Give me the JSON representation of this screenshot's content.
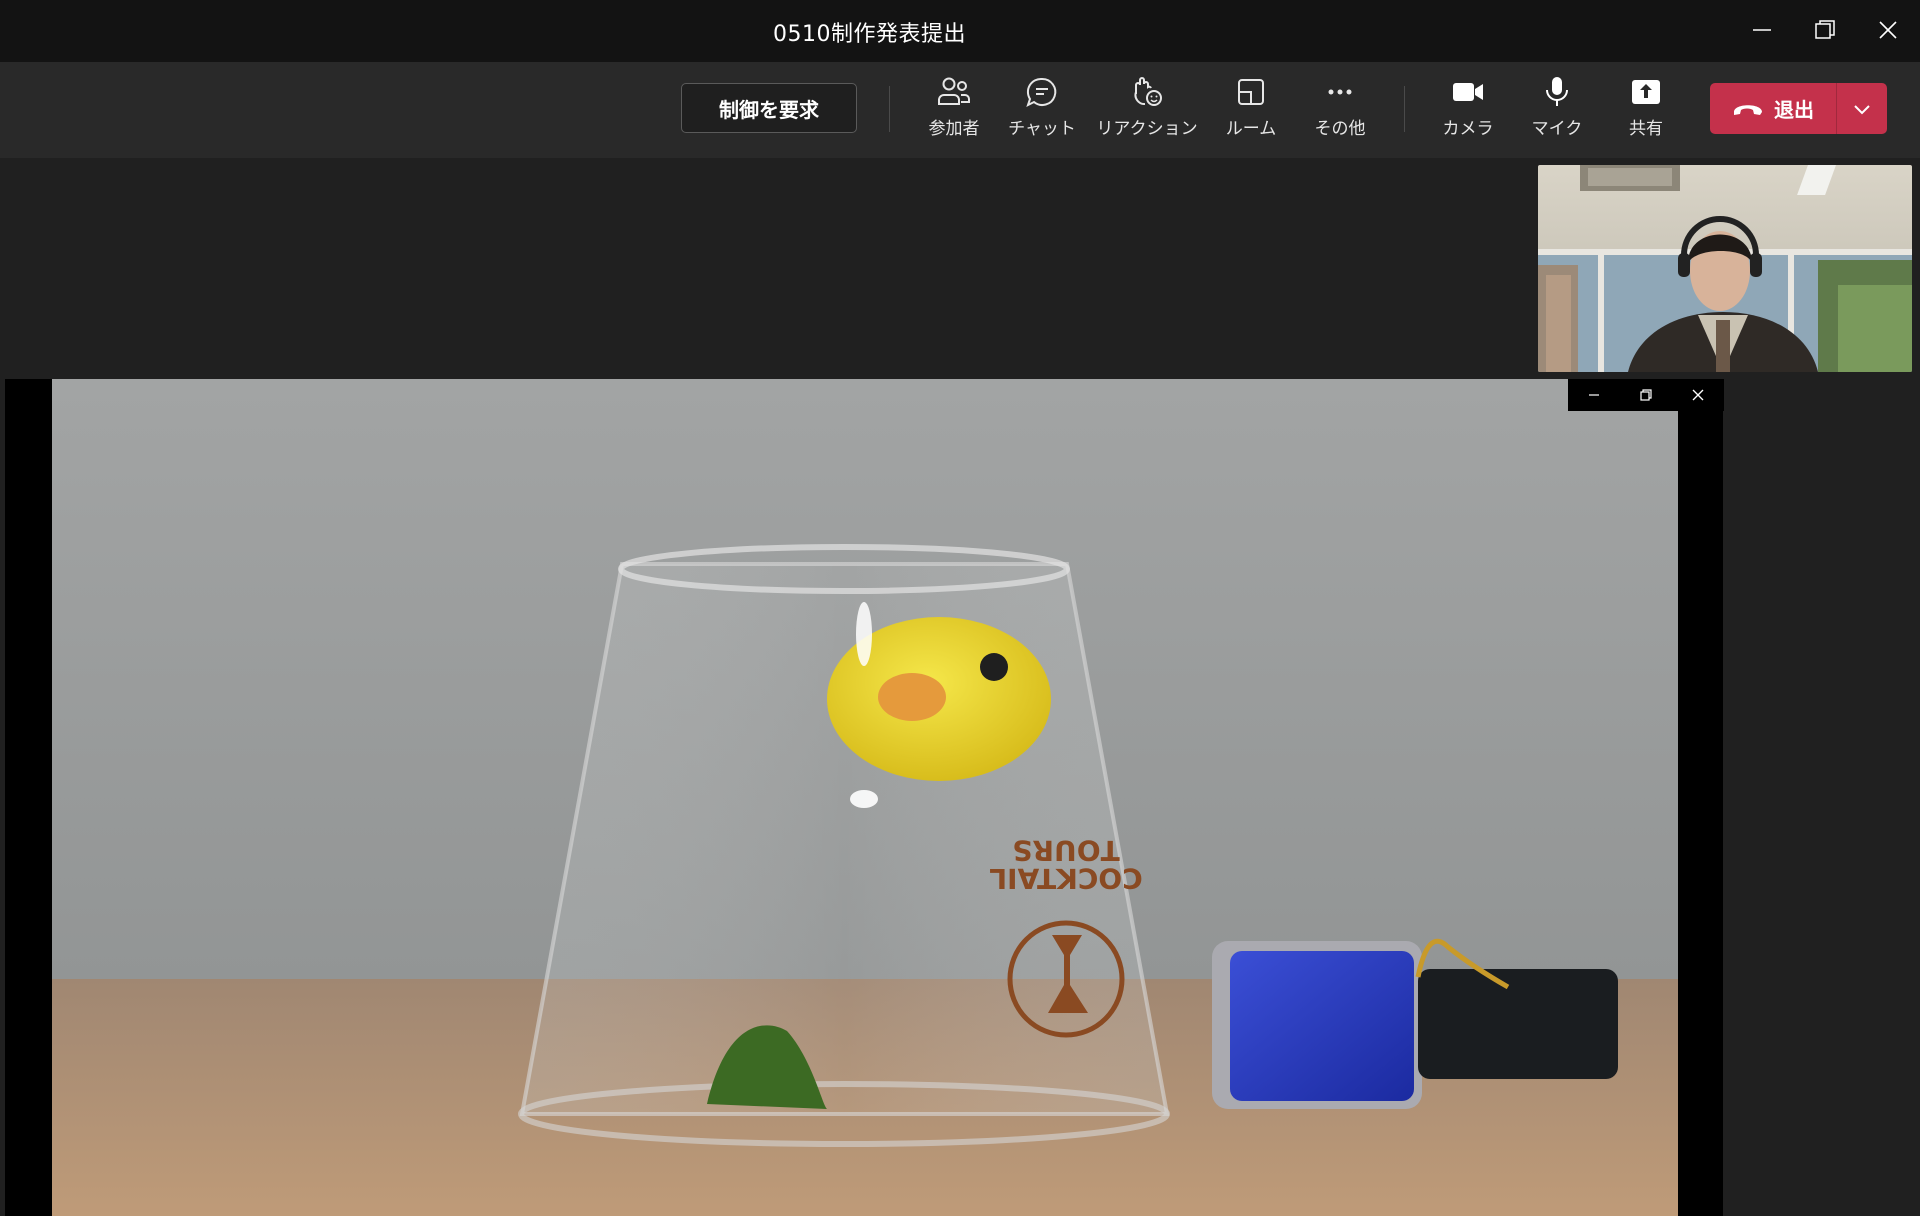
{
  "window": {
    "title": "0510制作発表提出"
  },
  "toolbar": {
    "request_control_label": "制御を要求",
    "items": [
      {
        "label": "参加者",
        "icon": "participants-icon"
      },
      {
        "label": "チャット",
        "icon": "chat-icon"
      },
      {
        "label": "リアクション",
        "icon": "reaction-icon"
      },
      {
        "label": "ルーム",
        "icon": "rooms-icon"
      },
      {
        "label": "その他",
        "icon": "more-icon"
      },
      {
        "label": "カメラ",
        "icon": "camera-icon"
      },
      {
        "label": "マイク",
        "icon": "mic-icon"
      },
      {
        "label": "共有",
        "icon": "share-icon"
      }
    ],
    "leave_label": "退出"
  },
  "colors": {
    "titlebar_bg": "#131313",
    "toolbar_bg": "#292929",
    "stage_bg": "#202020",
    "leave_red": "#c4314b"
  }
}
